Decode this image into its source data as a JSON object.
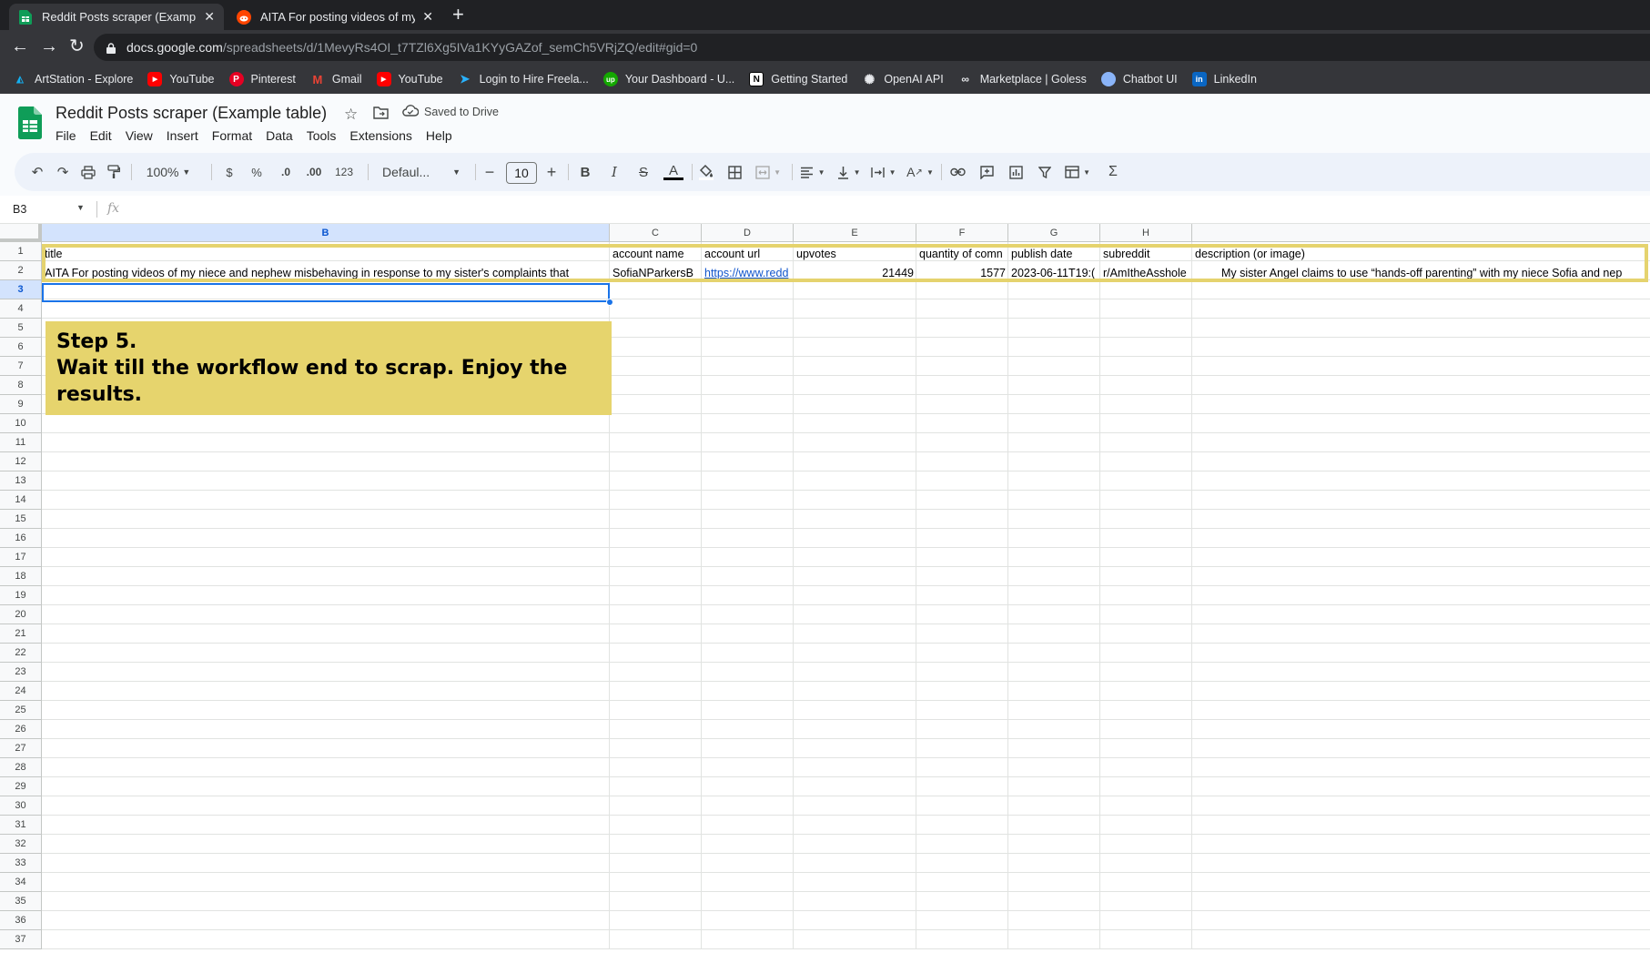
{
  "browser": {
    "tabs": [
      {
        "title": "Reddit Posts scraper (Example table)",
        "active": true
      },
      {
        "title": "AITA For posting videos of my niece and nephew",
        "active": false
      }
    ],
    "url_host": "docs.google.com",
    "url_path": "/spreadsheets/d/1MevyRs4OI_t7TZl6Xg5IVa1KYyGAZof_semCh5VRjZQ/edit#gid=0",
    "bookmarks": [
      {
        "label": "ArtStation - Explore",
        "icon": "artstation-icon"
      },
      {
        "label": "YouTube",
        "icon": "youtube-icon"
      },
      {
        "label": "Pinterest",
        "icon": "pinterest-icon"
      },
      {
        "label": "Gmail",
        "icon": "gmail-icon"
      },
      {
        "label": "YouTube",
        "icon": "youtube-icon"
      },
      {
        "label": "Login to Hire Freela...",
        "icon": "freelancer-icon"
      },
      {
        "label": "Your Dashboard - U...",
        "icon": "upwork-icon"
      },
      {
        "label": "Getting Started",
        "icon": "notion-icon"
      },
      {
        "label": "OpenAI API",
        "icon": "openai-icon"
      },
      {
        "label": "Marketplace | Goless",
        "icon": "goless-icon"
      },
      {
        "label": "Chatbot UI",
        "icon": "chat-bubble-icon"
      },
      {
        "label": "LinkedIn",
        "icon": "linkedin-icon"
      }
    ]
  },
  "doc": {
    "title": "Reddit Posts scraper (Example table)",
    "saved_status": "Saved to Drive",
    "menu": [
      "File",
      "Edit",
      "View",
      "Insert",
      "Format",
      "Data",
      "Tools",
      "Extensions",
      "Help"
    ]
  },
  "toolbar": {
    "zoom": "100%",
    "currency": "$",
    "percent": "%",
    "dec_decrease": ".0",
    "dec_increase": ".00",
    "number_format": "123",
    "font": "Defaul...",
    "font_size": "10",
    "bold": "B",
    "italic": "I",
    "text_color": "A",
    "sum": "Σ"
  },
  "formula_bar": {
    "cell_ref": "B3",
    "fx": "fx",
    "value": ""
  },
  "sheet": {
    "columns": [
      "B",
      "C",
      "D",
      "E",
      "F",
      "G",
      "H"
    ],
    "selected_column": "B",
    "selected_row": "3",
    "rows": [
      "1",
      "2",
      "3",
      "4",
      "5",
      "6",
      "7",
      "8",
      "9",
      "10",
      "11",
      "12",
      "13",
      "14",
      "15",
      "16",
      "17",
      "18",
      "19",
      "20",
      "21",
      "22",
      "23",
      "24",
      "25",
      "26",
      "27",
      "28",
      "29",
      "30",
      "31",
      "32",
      "33",
      "34",
      "35",
      "36",
      "37"
    ],
    "header_row": {
      "title": "title",
      "account_name": "account name",
      "account_url": "account url",
      "upvotes": "upvotes",
      "quantity_of_comments": "quantity of comn",
      "publish_date": "publish date",
      "subreddit": "subreddit",
      "description": "description (or image)"
    },
    "data_row": {
      "title": "AITA For posting videos of my niece and nephew misbehaving in response to my sister's complaints that",
      "account_name": "SofiaNParkersB",
      "account_url": "https://www.redd",
      "upvotes": "21449",
      "quantity_of_comments": "1577",
      "publish_date": "2023-06-11T19:(",
      "subreddit": "r/AmItheAsshole",
      "description": "My sister Angel claims to use “hands-off parenting” with my niece Sofia and nep"
    }
  },
  "note": {
    "line1": "Step 5.",
    "line2": "Wait till the workflow end to scrap. Enjoy the results."
  },
  "colors": {
    "highlight_border": "#e5d36e",
    "note_bg": "#e6d46d",
    "selection": "#1a73e8",
    "link": "#1155cc"
  }
}
